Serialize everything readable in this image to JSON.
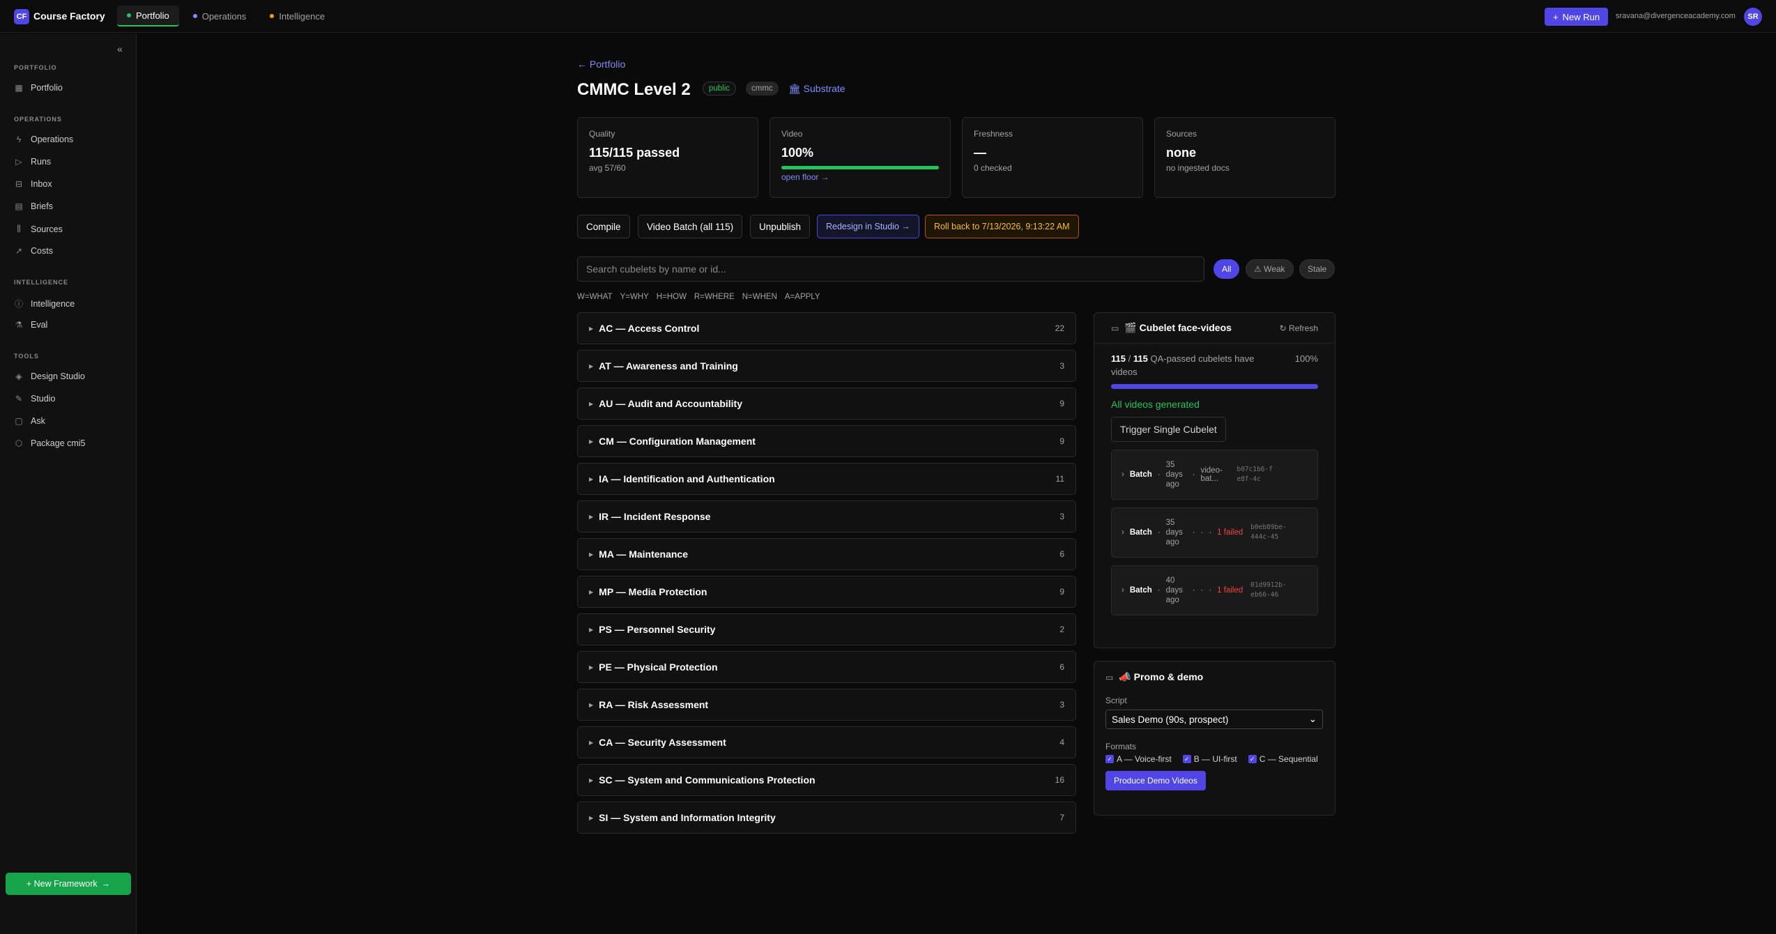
{
  "header": {
    "logo": "CF",
    "app_name": "Course Factory",
    "tabs": [
      {
        "label": "Portfolio",
        "dot": "#22c55e"
      },
      {
        "label": "Operations",
        "dot": "#818cf8"
      },
      {
        "label": "Intelligence",
        "dot": "#f59e0b"
      }
    ],
    "new_run": "New Run",
    "email": "sravana@divergenceacademy.com",
    "avatar": "SR"
  },
  "sidebar": {
    "collapse_icon": "«",
    "sections": [
      {
        "title": "PORTFOLIO"
      },
      {
        "title": "OPERATIONS"
      },
      {
        "title": "INTELLIGENCE"
      },
      {
        "title": "TOOLS"
      }
    ],
    "items": [
      {
        "label": "Portfolio",
        "icon": "grid-icon"
      },
      {
        "label": "Operations",
        "icon": "bolt-icon"
      },
      {
        "label": "Runs",
        "icon": "play-icon"
      },
      {
        "label": "Inbox",
        "icon": "inbox-icon"
      },
      {
        "label": "Briefs",
        "icon": "document-icon"
      },
      {
        "label": "Sources",
        "icon": "library-icon"
      },
      {
        "label": "Costs",
        "icon": "trend-icon"
      },
      {
        "label": "Intelligence",
        "icon": "info-icon"
      },
      {
        "label": "Eval",
        "icon": "flask-icon"
      },
      {
        "label": "Design Studio",
        "icon": "layers-icon"
      },
      {
        "label": "Studio",
        "icon": "palette-icon"
      },
      {
        "label": "Ask",
        "icon": "chat-icon"
      },
      {
        "label": "Package cmi5",
        "icon": "package-icon"
      }
    ],
    "new_framework": "+ New Framework"
  },
  "page": {
    "back": "← Portfolio",
    "title": "CMMC Level 2",
    "badge_public": "public",
    "badge_tag": "cmmc",
    "substrate": "🏛 Substrate"
  },
  "stats": [
    {
      "label": "Quality",
      "value": "115/115 passed",
      "sub": "avg 57/60"
    },
    {
      "label": "Video",
      "value": "100%",
      "link": "open floor →",
      "progress": 1.0
    },
    {
      "label": "Freshness",
      "value": "—",
      "sub": "0 checked"
    },
    {
      "label": "Sources",
      "value": "none",
      "sub": "no ingested docs"
    }
  ],
  "actions": {
    "compile": "Compile",
    "video_batch": "Video Batch (all 115)",
    "unpublish": "Unpublish",
    "redesign": "Redesign in Studio →",
    "rollback": "Roll back to 7/13/2026, 9:13:22 AM"
  },
  "search": {
    "placeholder": "Search cubelets by name or id..."
  },
  "filters": {
    "all": "All",
    "weak": "⚠ Weak",
    "stale": "Stale"
  },
  "legend": [
    "W=WHAT",
    "Y=WHY",
    "H=HOW",
    "R=WHERE",
    "N=WHEN",
    "A=APPLY"
  ],
  "domains": [
    {
      "name": "AC — Access Control",
      "count": "22"
    },
    {
      "name": "AT — Awareness and Training",
      "count": "3"
    },
    {
      "name": "AU — Audit and Accountability",
      "count": "9"
    },
    {
      "name": "CM — Configuration Management",
      "count": "9"
    },
    {
      "name": "IA — Identification and Authentication",
      "count": "11"
    },
    {
      "name": "IR — Incident Response",
      "count": "3"
    },
    {
      "name": "MA — Maintenance",
      "count": "6"
    },
    {
      "name": "MP — Media Protection",
      "count": "9"
    },
    {
      "name": "PS — Personnel Security",
      "count": "2"
    },
    {
      "name": "PE — Physical Protection",
      "count": "6"
    },
    {
      "name": "RA — Risk Assessment",
      "count": "3"
    },
    {
      "name": "CA — Security Assessment",
      "count": "4"
    },
    {
      "name": "SC — System and Communications Protection",
      "count": "16"
    },
    {
      "name": "SI — System and Information Integrity",
      "count": "7"
    }
  ],
  "video_panel": {
    "title": "🎬 Cubelet face-videos",
    "refresh": "Refresh",
    "count_a": "115",
    "slash": "/",
    "count_b": "115",
    "desc_1": "QA-passed cubelets have",
    "desc_2": "videos",
    "pct": "100%",
    "progress": 1.0,
    "status": "All videos generated",
    "trigger": "Trigger Single Cubelet",
    "batches": [
      {
        "label": "Batch",
        "ago": "35 days ago",
        "extra": "video-bat...",
        "failed": "",
        "id": "b07c1b6-fe8f-4c"
      },
      {
        "label": "Batch",
        "ago": "35 days ago",
        "extra": "·",
        "failed": "1 failed",
        "id": "b0eb89be-444c-45"
      },
      {
        "label": "Batch",
        "ago": "40 days ago",
        "extra": "·",
        "failed": "1 failed",
        "id": "01d9912b-eb66-46"
      }
    ]
  },
  "promo": {
    "title": "📣 Promo & demo",
    "script_label": "Script",
    "script_value": "Sales Demo (90s, prospect)",
    "formats_label": "Formats",
    "formats": [
      "A — Voice-first",
      "B — UI-first",
      "C — Sequential"
    ],
    "produce": "Produce Demo Videos"
  }
}
